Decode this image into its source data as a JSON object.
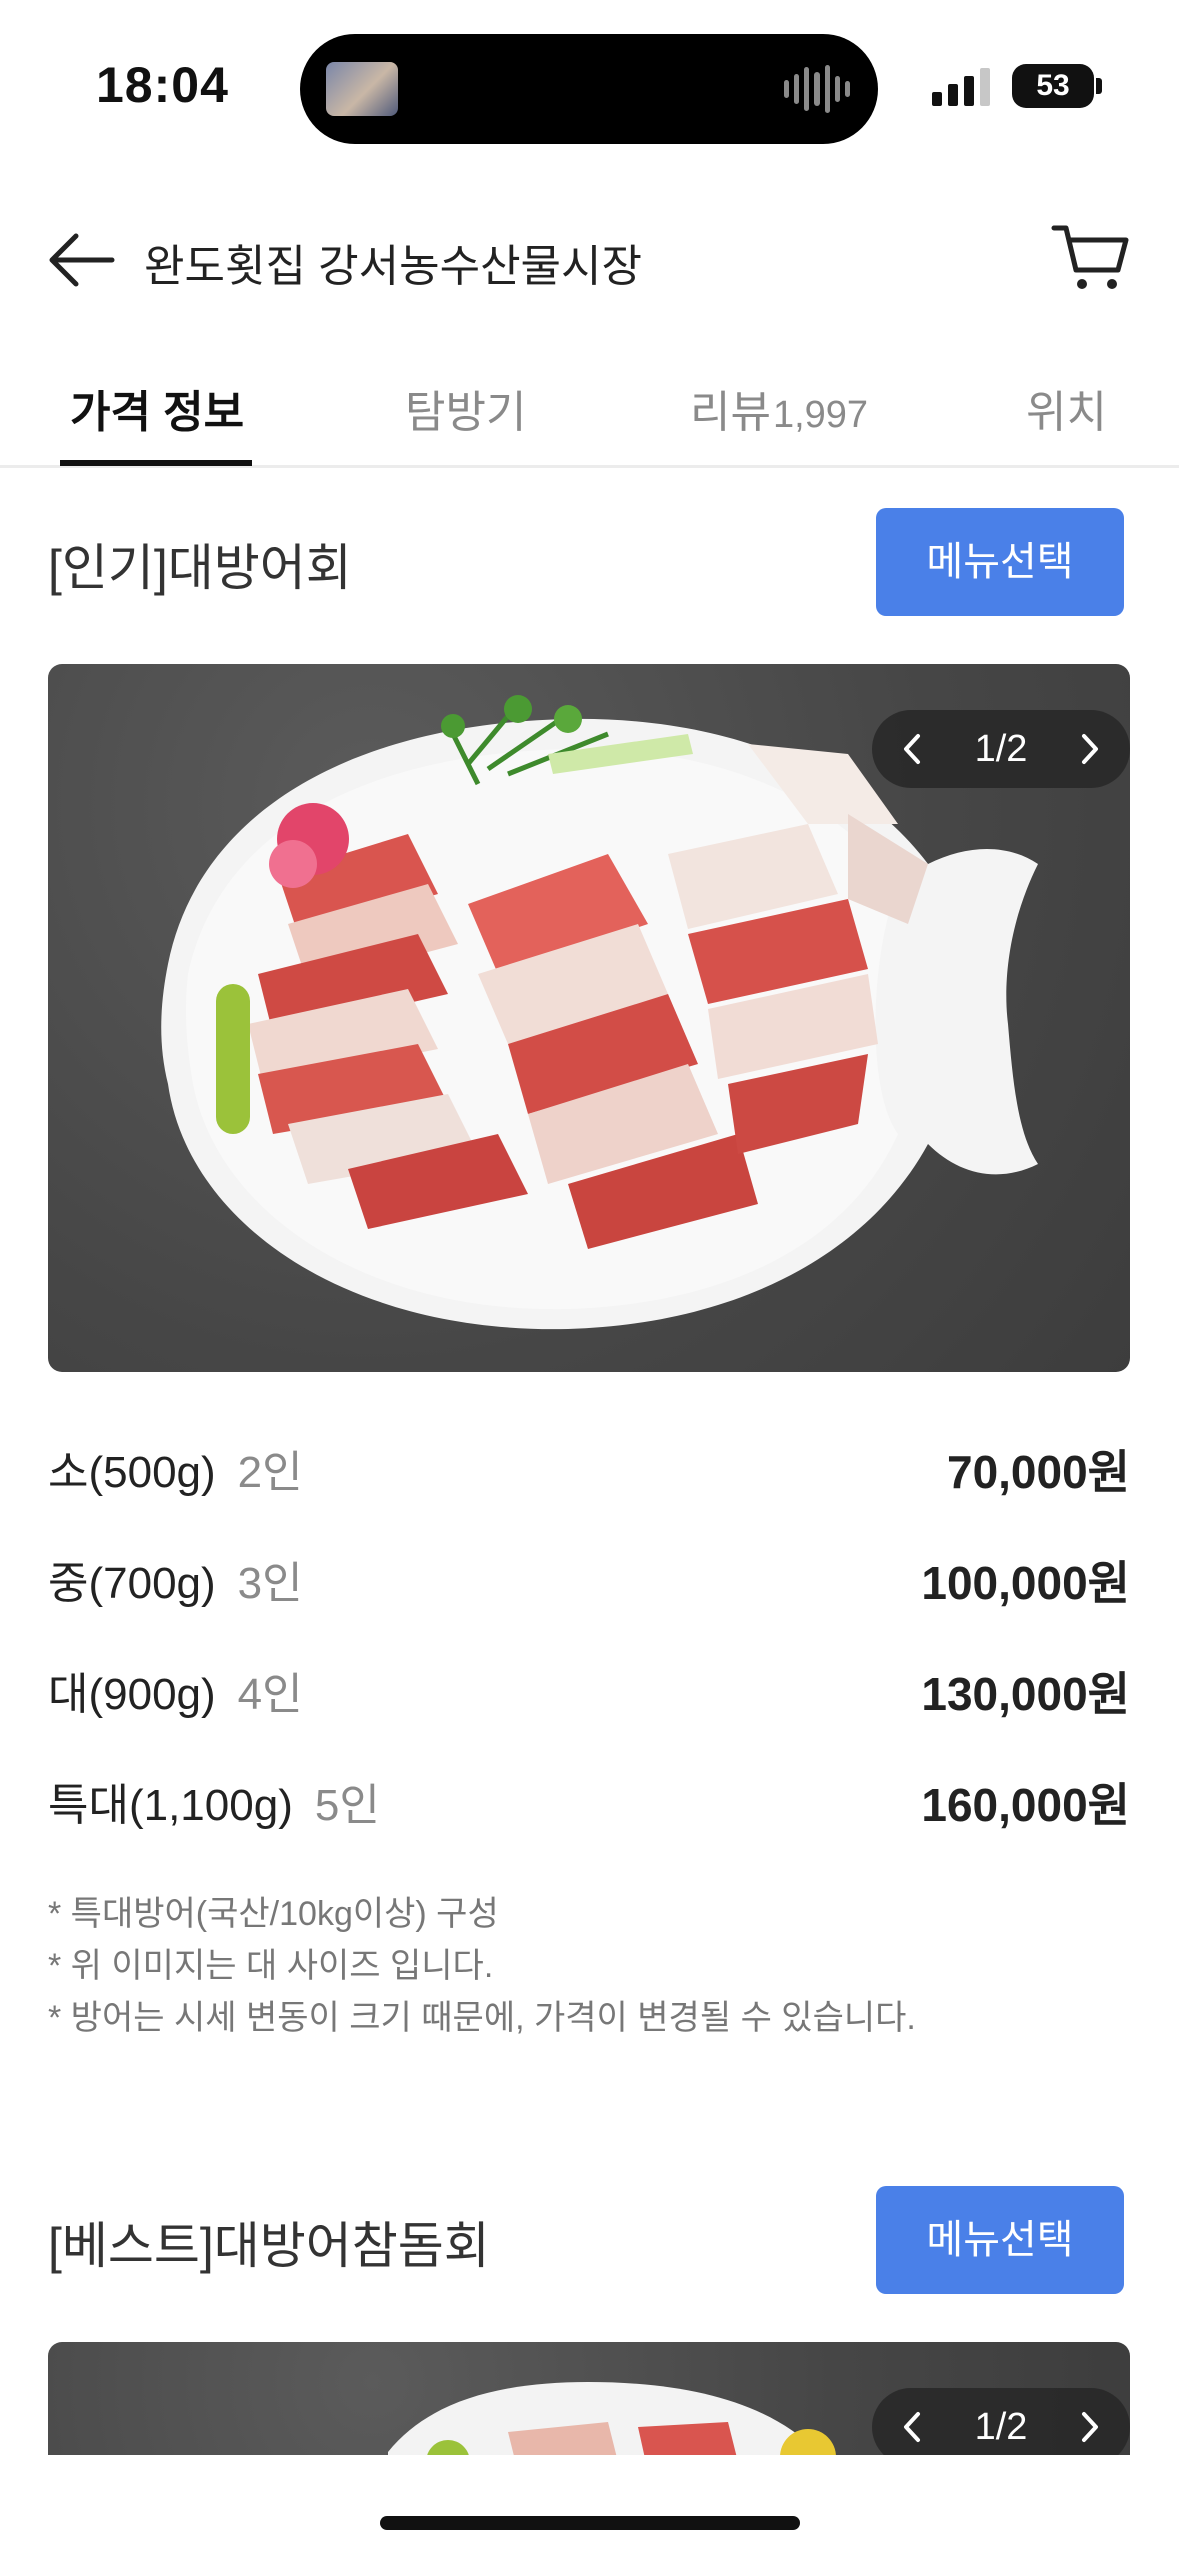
{
  "status_bar": {
    "time": "18:04",
    "battery": "53"
  },
  "header": {
    "title": "완도횟집 강서농수산물시장",
    "back_icon": "arrow-left-icon",
    "cart_icon": "cart-icon"
  },
  "tabs": [
    {
      "label": "가격 정보",
      "count": "",
      "active": true
    },
    {
      "label": "탐방기",
      "count": "",
      "active": false
    },
    {
      "label": "리뷰",
      "count": "1,997",
      "active": false
    },
    {
      "label": "위치",
      "count": "",
      "active": false
    }
  ],
  "menus": [
    {
      "title": "[인기]대방어회",
      "select_label": "메뉴선택",
      "pager": "1/2",
      "prices": [
        {
          "size": "소(500g)",
          "people": "2인",
          "price": "70,000원"
        },
        {
          "size": "중(700g)",
          "people": "3인",
          "price": "100,000원"
        },
        {
          "size": "대(900g)",
          "people": "4인",
          "price": "130,000원"
        },
        {
          "size": "특대(1,100g)",
          "people": "5인",
          "price": "160,000원"
        }
      ],
      "notes": [
        "* 특대방어(국산/10kg이상) 구성",
        "* 위 이미지는 대 사이즈 입니다.",
        "* 방어는 시세 변동이 크기 때문에, 가격이 변경될 수 있습니다."
      ]
    },
    {
      "title": "[베스트]대방어참돔회",
      "select_label": "메뉴선택",
      "pager": "1/2"
    }
  ],
  "colors": {
    "accent": "#4a80e8",
    "text_primary": "#222222",
    "text_secondary": "#8a8a8a"
  }
}
